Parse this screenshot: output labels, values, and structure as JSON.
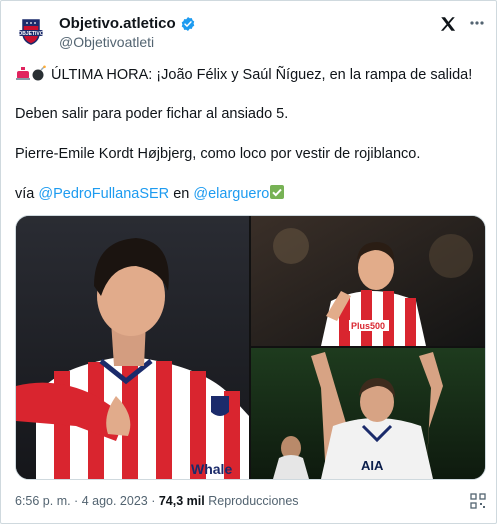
{
  "author": {
    "name": "Objetivo.atletico",
    "handle": "@Objetivoatleti",
    "avatar_label": "OBJETIVO"
  },
  "tweet": {
    "line1_prefix_emojis": [
      "siren-emoji",
      "bomb-emoji"
    ],
    "line1_text": "ÚLTIMA HORA: ¡João Félix y Saúl Ñíguez, en la rampa de salida!",
    "line2_text": "Deben salir para poder fichar al ansiado 5.",
    "line3_text": "Pierre-Emile Kordt Højbjerg, como loco por vestir de rojiblanco.",
    "line4_via": "vía",
    "line4_mention1": "@PedroFullanaSER",
    "line4_en": "en",
    "line4_mention2": "@elarguero",
    "line4_emoji": "check-mark-emoji"
  },
  "media": {
    "photo1_name": "joao-felix-photo",
    "photo2_name": "saul-niguez-photo",
    "photo3_name": "hojbjerg-photo",
    "jersey_text": "Whale",
    "jersey2_text": "Plus500",
    "jersey3_text": "AIA"
  },
  "footer": {
    "time": "6:56 p. m. · 4 ago. 2023 ·",
    "views_count": "74,3 mil",
    "views_label": "Reproducciones"
  },
  "colors": {
    "link": "#1d9bf0",
    "verified": "#1d9bf0",
    "secondary_text": "#536471"
  }
}
